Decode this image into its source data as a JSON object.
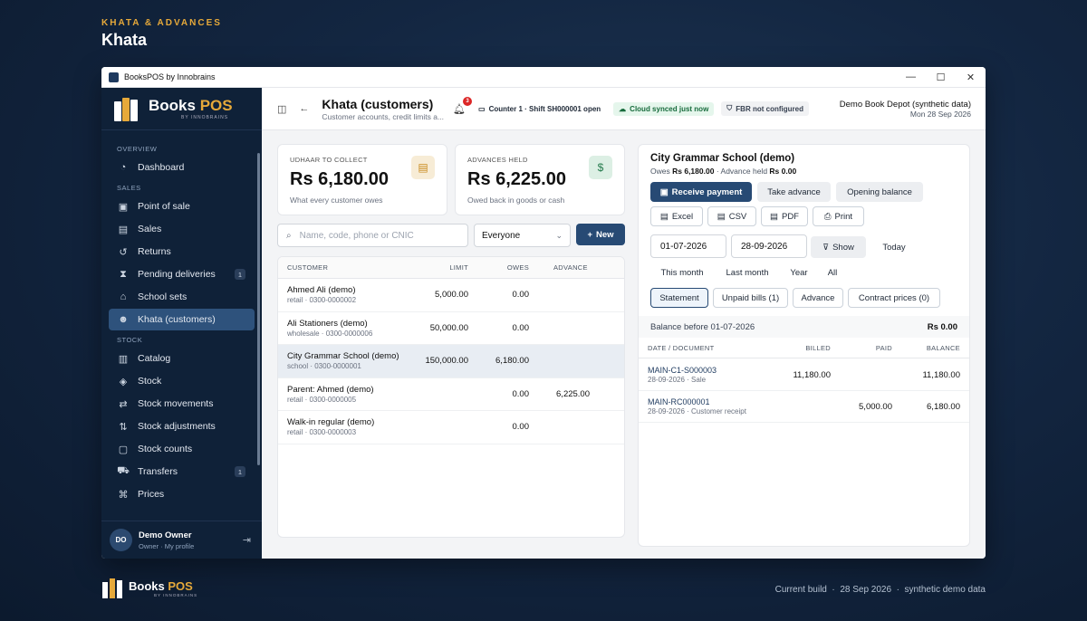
{
  "page": {
    "eyebrow": "KHATA & ADVANCES",
    "title": "Khata"
  },
  "window": {
    "title": "BooksPOS by Innobrains"
  },
  "brand": {
    "name_a": "Books",
    "name_b": "POS",
    "sub": "BY INNOBRAINS"
  },
  "sidebar": {
    "sections": [
      {
        "label": "OVERVIEW",
        "items": [
          {
            "label": "Dashboard",
            "icon": "dashboard-icon"
          }
        ]
      },
      {
        "label": "SALES",
        "items": [
          {
            "label": "Point of sale",
            "icon": "scan-icon"
          },
          {
            "label": "Sales",
            "icon": "receipt-icon"
          },
          {
            "label": "Returns",
            "icon": "return-icon"
          },
          {
            "label": "Pending deliveries",
            "icon": "hourglass-icon",
            "count": "1"
          },
          {
            "label": "School sets",
            "icon": "school-icon"
          },
          {
            "label": "Khata (customers)",
            "icon": "users-icon",
            "active": true
          }
        ]
      },
      {
        "label": "STOCK",
        "items": [
          {
            "label": "Catalog",
            "icon": "book-icon"
          },
          {
            "label": "Stock",
            "icon": "box-icon"
          },
          {
            "label": "Stock movements",
            "icon": "arrows-icon"
          },
          {
            "label": "Stock adjustments",
            "icon": "adjust-icon"
          },
          {
            "label": "Stock counts",
            "icon": "clipboard-icon"
          },
          {
            "label": "Transfers",
            "icon": "truck-icon",
            "count": "1"
          },
          {
            "label": "Prices",
            "icon": "tag-icon"
          }
        ]
      }
    ],
    "user": {
      "initials": "DO",
      "name": "Demo Owner",
      "role": "Owner",
      "profile_link": "My profile"
    }
  },
  "topbar": {
    "title": "Khata (customers)",
    "subtitle": "Customer accounts, credit limits a...",
    "notifications": "3",
    "counter": "Counter 1 · Shift SH000001 open",
    "sync": "Cloud synced just now",
    "fbr": "FBR not configured",
    "store_name": "Demo Book Depot (synthetic data)",
    "store_date": "Mon 28 Sep 2026"
  },
  "stats": {
    "udhaar": {
      "label": "UDHAAR TO COLLECT",
      "value": "Rs 6,180.00",
      "note": "What every customer owes",
      "icon_color": "#f7ecd6"
    },
    "advances": {
      "label": "ADVANCES HELD",
      "value": "Rs 6,225.00",
      "note": "Owed back in goods or cash",
      "icon_color": "#dcefe4"
    }
  },
  "filters": {
    "search_placeholder": "Name, code, phone or CNIC",
    "segment": "Everyone",
    "new_label": "New"
  },
  "customers": {
    "headers": {
      "customer": "CUSTOMER",
      "limit": "LIMIT",
      "owes": "OWES",
      "advance": "ADVANCE"
    },
    "rows": [
      {
        "name": "Ahmed Ali (demo)",
        "sub": "retail · 0300-0000002",
        "limit": "5,000.00",
        "owes": "0.00",
        "advance": ""
      },
      {
        "name": "Ali Stationers (demo)",
        "sub": "wholesale · 0300-0000006",
        "limit": "50,000.00",
        "owes": "0.00",
        "advance": ""
      },
      {
        "name": "City Grammar School (demo)",
        "sub": "school · 0300-0000001",
        "limit": "150,000.00",
        "owes": "6,180.00",
        "advance": "",
        "selected": true
      },
      {
        "name": "Parent: Ahmed (demo)",
        "sub": "retail · 0300-0000005",
        "limit": "",
        "owes": "0.00",
        "advance": "6,225.00"
      },
      {
        "name": "Walk-in regular (demo)",
        "sub": "retail · 0300-0000003",
        "limit": "",
        "owes": "0.00",
        "advance": ""
      }
    ]
  },
  "detail": {
    "name": "City Grammar School (demo)",
    "owes_prefix": "Owes",
    "owes_value": "Rs 6,180.00",
    "advance_text": "· Advance held",
    "advance_value": "Rs 0.00",
    "actions": {
      "receive": "Receive payment",
      "take_advance": "Take advance",
      "opening": "Opening balance"
    },
    "exports": {
      "excel": "Excel",
      "csv": "CSV",
      "pdf": "PDF",
      "print": "Print"
    },
    "date_from": "01-07-2026",
    "date_to": "28-09-2026",
    "show": "Show",
    "today": "Today",
    "ranges": {
      "this_month": "This month",
      "last_month": "Last month",
      "year": "Year",
      "all": "All"
    },
    "tabs": {
      "statement": "Statement",
      "unpaid": "Unpaid bills (1)",
      "advance": "Advance",
      "contract": "Contract prices (0)"
    },
    "balance_before_label": "Balance before 01-07-2026",
    "balance_before_value": "Rs 0.00",
    "ledger_headers": {
      "doc": "DATE / DOCUMENT",
      "billed": "BILLED",
      "paid": "PAID",
      "balance": "BALANCE"
    },
    "ledger": [
      {
        "doc": "MAIN-C1-S000003",
        "sub": "28-09-2026 · Sale",
        "billed": "11,180.00",
        "paid": "",
        "balance": "11,180.00"
      },
      {
        "doc": "MAIN-RC000001",
        "sub": "28-09-2026 · Customer receipt",
        "billed": "",
        "paid": "5,000.00",
        "balance": "6,180.00"
      }
    ]
  },
  "footer": {
    "build": "Current build",
    "date": "28 Sep 2026",
    "note": "synthetic demo data"
  }
}
